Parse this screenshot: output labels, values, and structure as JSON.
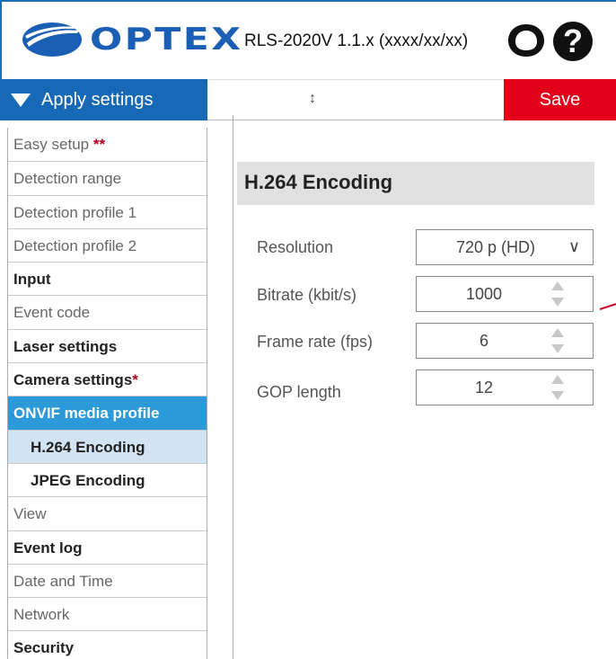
{
  "header": {
    "brand": "OPTEX",
    "model_version": "RLS-2020V 1.1.x (xxxx/xx/xx)",
    "user_icon": "user-account-icon",
    "help_icon": "help-icon",
    "help_glyph": "?"
  },
  "toolbar": {
    "apply_label": "Apply settings",
    "resize_glyph": "↕",
    "save_label": "Save"
  },
  "sidebar": {
    "items": [
      {
        "label": "Easy setup",
        "suffix": "**"
      },
      {
        "label": "Detection range"
      },
      {
        "label": "Detection profile 1"
      },
      {
        "label": "Detection profile 2"
      },
      {
        "label": "Input"
      },
      {
        "label": "Event code"
      },
      {
        "label": "Laser settings"
      },
      {
        "label": "Camera settings",
        "suffix": "*"
      },
      {
        "label": "ONVIF media profile"
      },
      {
        "label": "H.264 Encoding"
      },
      {
        "label": "JPEG Encoding"
      },
      {
        "label": "View"
      },
      {
        "label": "Event log"
      },
      {
        "label": "Date and Time"
      },
      {
        "label": "Network"
      },
      {
        "label": "Security"
      }
    ]
  },
  "main": {
    "section_title": "H.264 Encoding",
    "fields": {
      "resolution": {
        "label": "Resolution",
        "value": "720 p (HD)",
        "chevron": "∨"
      },
      "bitrate": {
        "label": "Bitrate (kbit/s)",
        "value": "1000"
      },
      "frame_rate": {
        "label": "Frame rate (fps)",
        "value": "6"
      },
      "gop_length": {
        "label": "GOP length",
        "value": "12"
      }
    }
  },
  "colors": {
    "brand_blue": "#1769b6",
    "active_blue": "#2c9ad8",
    "selected_bg": "#d2e4f3",
    "save_red": "#e3001b"
  }
}
